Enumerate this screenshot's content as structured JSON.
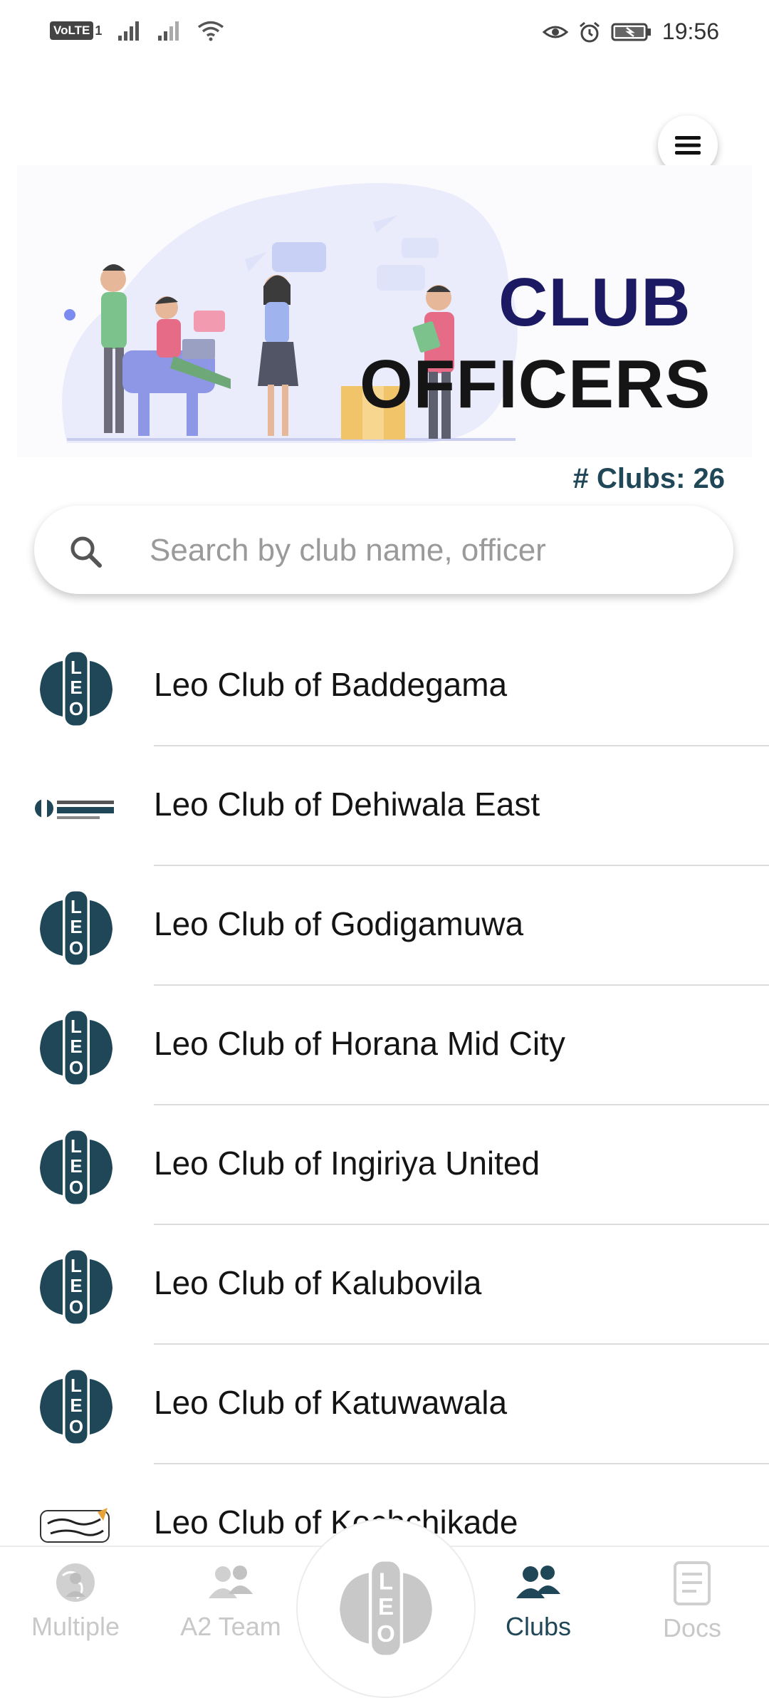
{
  "status_bar": {
    "volte": "VoLTE",
    "volte_sub": "1",
    "time": "19:56"
  },
  "banner": {
    "title_line1": "CLUB",
    "title_line2": "OFFICERS"
  },
  "clubs_count": "# Clubs: 26",
  "search": {
    "placeholder": "Search by club name, officer",
    "value": ""
  },
  "clubs": [
    {
      "name": "Leo Club of Baddegama",
      "logo": "leo-logo"
    },
    {
      "name": "Leo Club of Dehiwala East",
      "logo": "dehiwala-logo"
    },
    {
      "name": "Leo Club of Godigamuwa",
      "logo": "leo-logo"
    },
    {
      "name": "Leo Club of Horana Mid City",
      "logo": "leo-logo"
    },
    {
      "name": "Leo Club of Ingiriya United",
      "logo": "leo-logo"
    },
    {
      "name": "Leo Club of Kalubovila",
      "logo": "leo-logo"
    },
    {
      "name": "Leo Club of Katuwawala",
      "logo": "leo-logo"
    },
    {
      "name": "Leo Club of Kochchikade",
      "logo": "believe-logo"
    }
  ],
  "nav": {
    "multiple": "Multiple",
    "a2_team": "A2 Team",
    "clubs": "Clubs",
    "docs": "Docs"
  },
  "colors": {
    "accent": "#1f4757",
    "title_navy": "#1c1a63",
    "inactive": "#c8c8c8"
  }
}
